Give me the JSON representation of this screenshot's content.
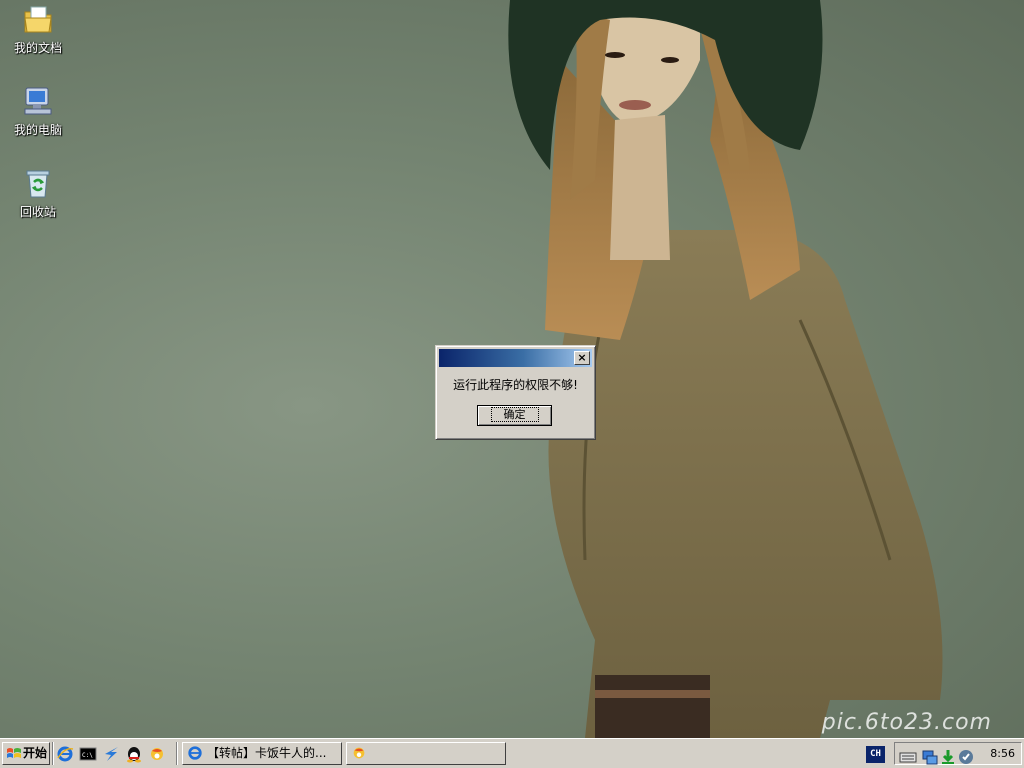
{
  "desktop": {
    "icons": [
      {
        "label": "我的文档",
        "icon": "my-documents-icon"
      },
      {
        "label": "我的电脑",
        "icon": "my-computer-icon"
      },
      {
        "label": "回收站",
        "icon": "recycle-bin-icon"
      }
    ]
  },
  "dialog": {
    "title": "",
    "message": "运行此程序的权限不够!",
    "ok_label": "确定",
    "close_glyph": "×"
  },
  "watermark": "pic.6to23.com",
  "taskbar": {
    "start_label": "开始",
    "quick_launch": [
      "ie-icon",
      "cmd-icon",
      "thunder-icon",
      "qq-icon",
      "browser-icon"
    ],
    "tasks": [
      {
        "label": "【转帖】卡饭牛人的...",
        "icon": "ie-icon",
        "active": false
      },
      {
        "label": "",
        "icon": "browser-icon",
        "active": false
      }
    ],
    "language": "CH",
    "tray_icons": [
      "keyboard-icon",
      "network-icon",
      "download-icon",
      "shield-icon"
    ],
    "clock": "8:56"
  },
  "colors": {
    "titlebar_start": "#0a246a",
    "titlebar_end": "#a6caf0",
    "face": "#d4d0c8"
  }
}
